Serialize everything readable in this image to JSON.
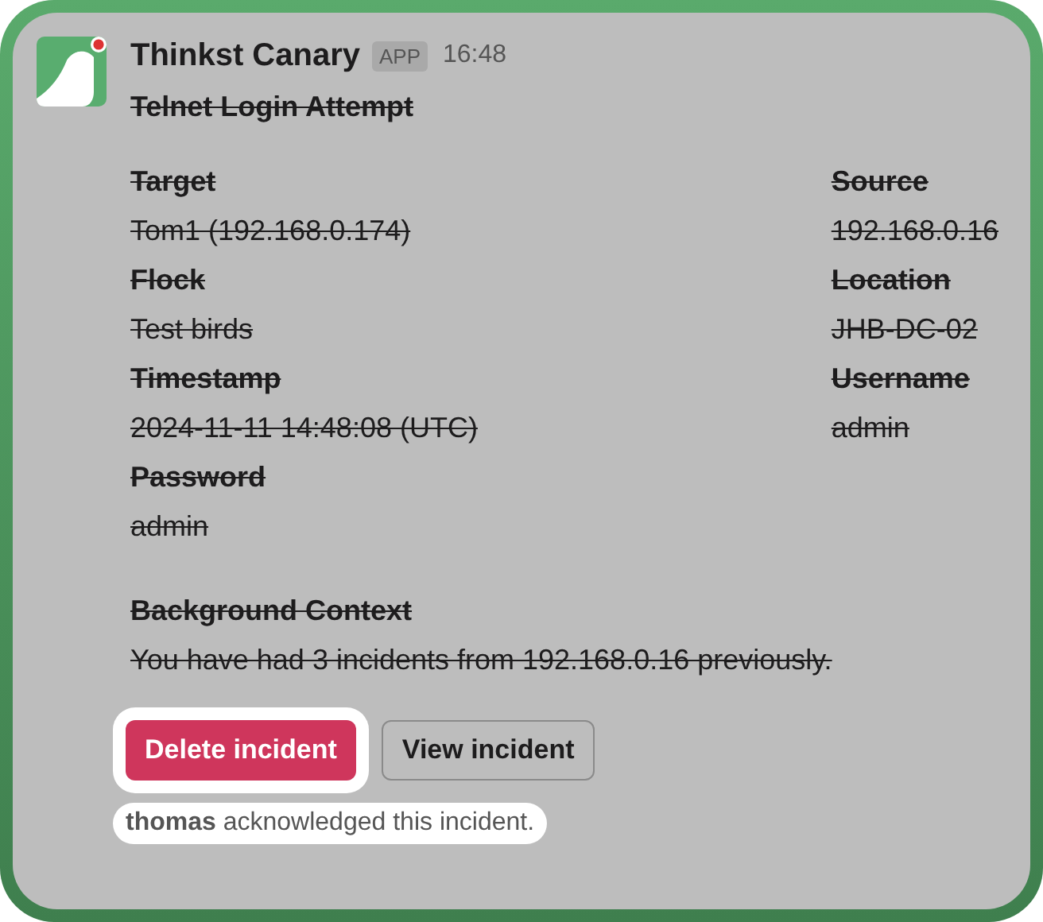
{
  "message": {
    "sender": "Thinkst Canary",
    "badge": "APP",
    "time": "16:48",
    "struck": true,
    "title": "Telnet Login Attempt",
    "fields": [
      {
        "label": "Target",
        "value": "Tom1 (192.168.0.174)"
      },
      {
        "label": "Source",
        "value": "192.168.0.16"
      },
      {
        "label": "Flock",
        "value": "Test birds"
      },
      {
        "label": "Location",
        "value": "JHB-DC-02"
      },
      {
        "label": "Timestamp",
        "value": "2024-11-11 14:48:08 (UTC)"
      },
      {
        "label": "Username",
        "value": "admin"
      },
      {
        "label": "Password",
        "value": "admin"
      }
    ],
    "context": {
      "label": "Background Context",
      "value": "You have had 3 incidents from 192.168.0.16 previously."
    },
    "buttons": [
      {
        "label": "Delete incident",
        "kind": "danger",
        "focused": true
      },
      {
        "label": "View incident",
        "kind": "default",
        "focused": false
      }
    ],
    "note": "**thomas** acknowledged this incident."
  }
}
